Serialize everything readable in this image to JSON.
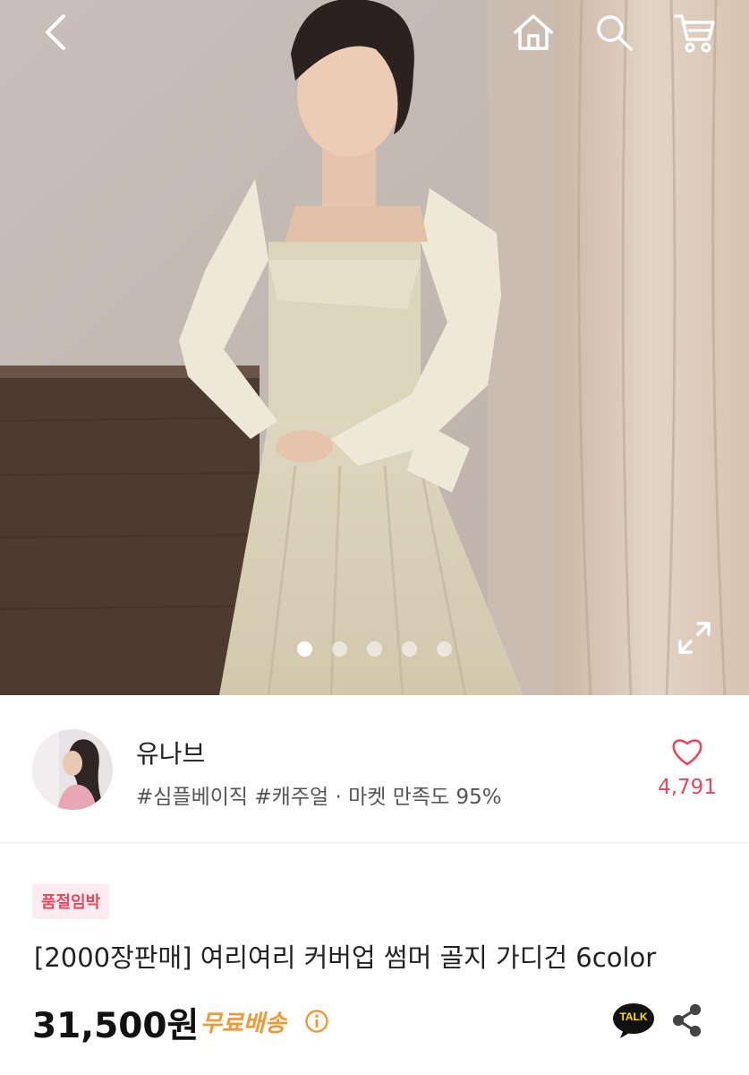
{
  "header": {
    "back_icon": "chevron-left-icon",
    "home_icon": "home-icon",
    "search_icon": "search-icon",
    "cart_icon": "cart-icon"
  },
  "gallery": {
    "image_alt": "product-photo-cardigan",
    "slide_count": 5,
    "active_slide": 1,
    "expand_icon": "expand-icon"
  },
  "seller": {
    "name": "유나브",
    "tags": "#심플베이직 #캐주얼 · 마켓 만족도 95%",
    "likes": "4,791"
  },
  "product": {
    "badge": "품절임박",
    "title": "[2000장판매] 여리여리 커버업 썸머 골지 가디건 6color",
    "price": "31,500원",
    "shipping": "무료배송",
    "talk_label": "TALK"
  },
  "colors": {
    "accent_pink": "#e64763",
    "shipping_orange": "#f09a35",
    "talk_yellow": "#ffde00"
  }
}
